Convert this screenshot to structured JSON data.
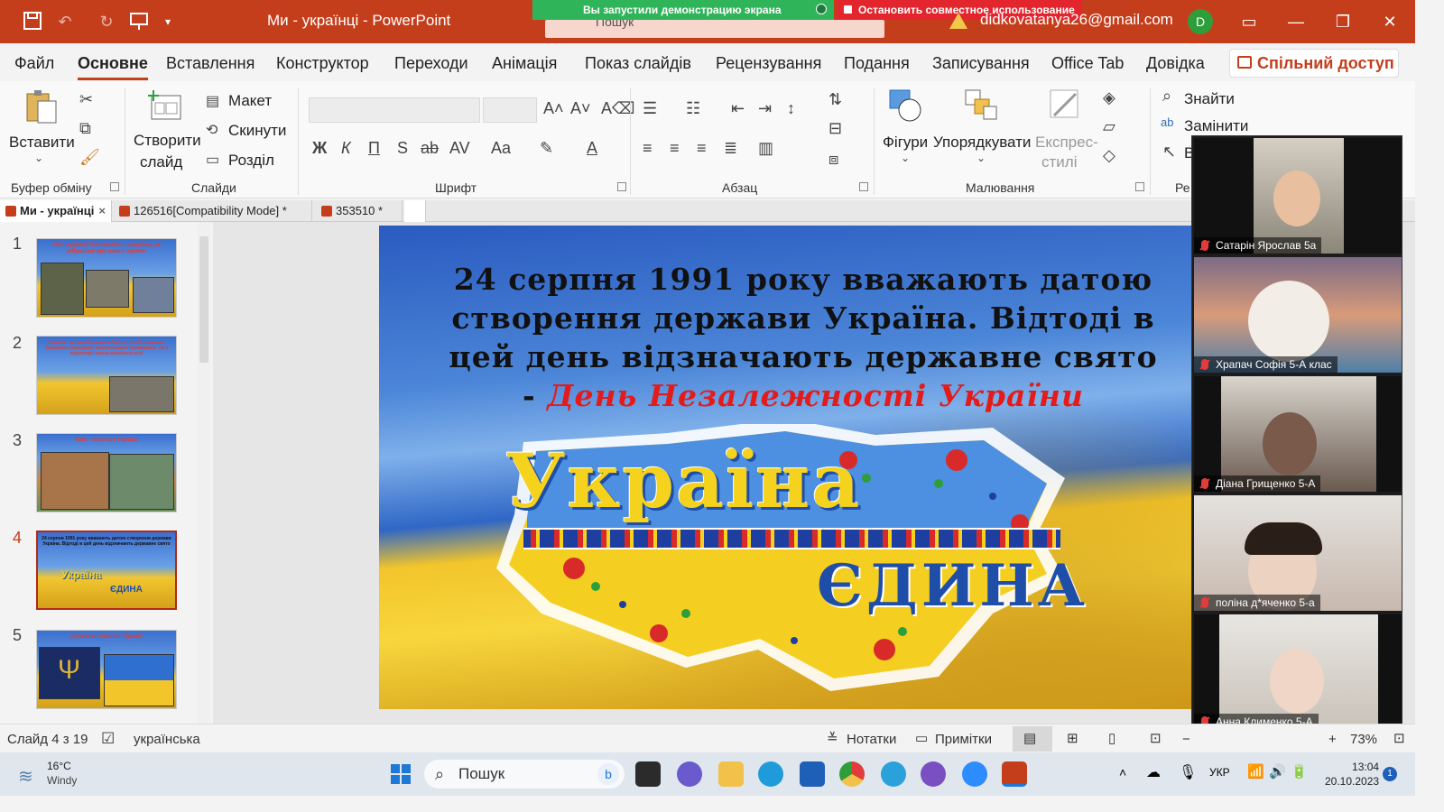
{
  "window": {
    "title": "Ми - українці  -  PowerPoint",
    "search_placeholder": "Пошук",
    "account": "didkovatanya26@gmail.com",
    "avatar_initial": "D",
    "screenshare_notice": "Вы запустили демонстрацию экрана",
    "stop_share": "Остановить совместное использование",
    "accent_color": "#c43e1c"
  },
  "menu": {
    "tabs": [
      "Файл",
      "Основне",
      "Вставлення",
      "Конструктор",
      "Переходи",
      "Анімація",
      "Показ слайдів",
      "Рецензування",
      "Подання",
      "Записування",
      "Office Tab",
      "Довідка"
    ],
    "active_tab": "Основне",
    "share_label": "Спільний доступ"
  },
  "ribbon": {
    "paste_label": "Вставити",
    "clipboard_group": "Буфер обміну",
    "new_slide_label_1": "Створити",
    "new_slide_label_2": "слайд",
    "layout_label": "Макет",
    "reset_label": "Скинути",
    "section_label": "Розділ",
    "slides_group": "Слайди",
    "font_group": "Шрифт",
    "paragraph_group": "Абзац",
    "shapes_label": "Фігури",
    "arrange_label": "Упорядкувати",
    "quick_styles_1": "Експрес-",
    "quick_styles_2": "стилі",
    "drawing_group": "Малювання",
    "find_label": "Знайти",
    "replace_label": "Замінити",
    "editing_group_partial": "Ре",
    "select_partial": "В",
    "font_buttons": [
      "Ж",
      "К",
      "П",
      "S",
      "ab",
      "AV",
      "Aa"
    ]
  },
  "doc_tabs": [
    {
      "label": "Ми - українці",
      "active": true
    },
    {
      "label": "126516[Compatibility Mode] *",
      "active": false
    },
    {
      "label": "353510 *",
      "active": false
    }
  ],
  "thumbnails": [
    {
      "num": "1",
      "caption": "«Ми українці! Пам'ятаймо, шануймо, не забуваймо про наших героїв»"
    },
    {
      "num": "2",
      "caption": "Україна - велика держава в Європі, у якій проживає більшість населення слов'янського походження. На її території кілька мільйонів осіб"
    },
    {
      "num": "3",
      "caption": "Київ - столиця України"
    },
    {
      "num": "4",
      "caption": "24 серпня 1991 року вважають датою створення держави Україна. Відтоді в цей день відзначають державне свято"
    },
    {
      "num": "5",
      "caption": "Державні символи України"
    }
  ],
  "active_slide": "4",
  "slide": {
    "line1": "24 серпня 1991 року вважають датою",
    "line2": "створення держави Україна. Відтоді в",
    "line3": "цей день відзначають державне свято",
    "line4_prefix": "-  ",
    "line4_red": "День Незалежності України",
    "word_ukraina": "Україна",
    "word_edyna": "ЄДИНА"
  },
  "participants": [
    "Сатарін Ярослав 5а",
    "Храпач  Софія 5-А клас",
    "Діана Грищенко 5-А",
    "поліна д*яченко 5-а",
    "Анна Клименко 5-А"
  ],
  "statusbar": {
    "slide_info": "Слайд 4 з 19",
    "language": "українська",
    "notes": "Нотатки",
    "comments": "Примітки",
    "zoom": "73%"
  },
  "taskbar": {
    "weather_temp": "16°C",
    "weather_desc": "Windy",
    "search": "Пошук",
    "lang": "УКР",
    "time": "13:04",
    "date": "20.10.2023"
  }
}
